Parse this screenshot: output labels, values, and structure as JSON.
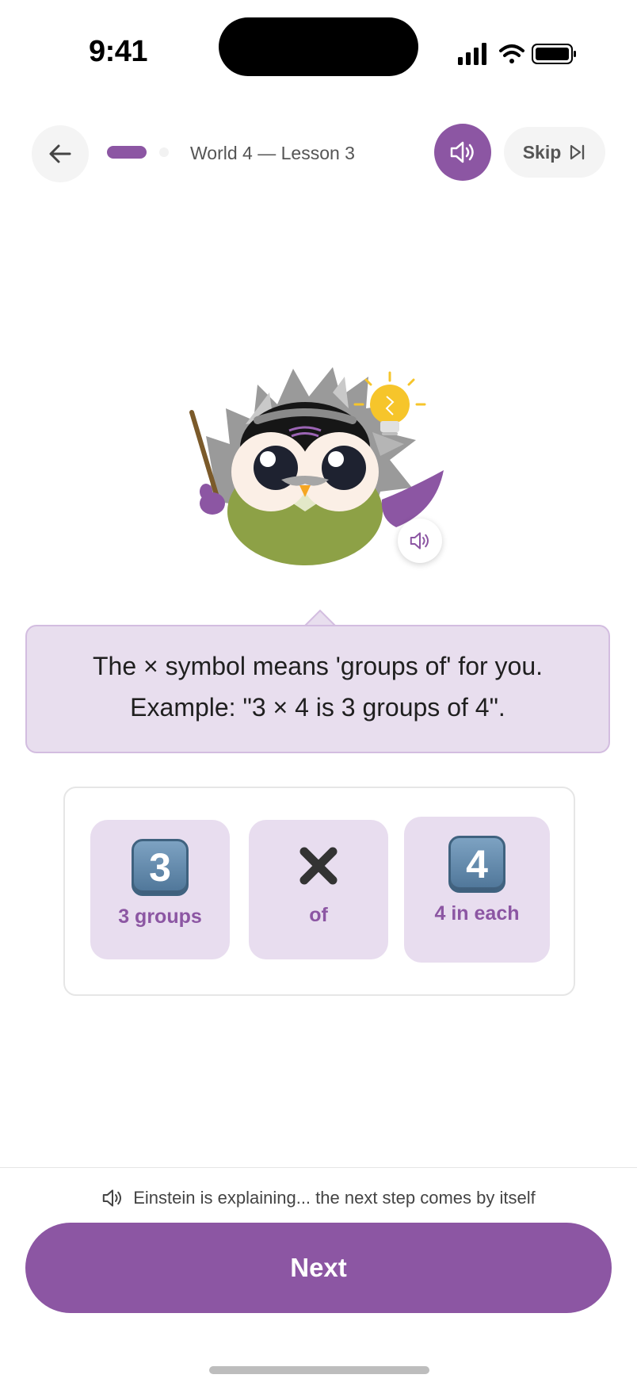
{
  "status_bar": {
    "time": "9:41"
  },
  "header": {
    "lesson_title": "World 4 — Lesson 3",
    "skip_label": "Skip",
    "progress_fraction": 0.5
  },
  "speech_bubble": {
    "line1": "The × symbol means 'groups of' for you.",
    "line2": "Example: \"3 × 4 is 3 groups of 4\"."
  },
  "example": {
    "tiles": [
      {
        "glyph": "3",
        "label": "3 groups",
        "icon": "keycap-3-icon"
      },
      {
        "glyph": "×",
        "label": "of",
        "icon": "multiply-icon"
      },
      {
        "glyph": "4",
        "label": "4 in each",
        "icon": "keycap-4-icon"
      }
    ]
  },
  "footer": {
    "status_message": "Einstein is explaining... the next step comes by itself",
    "next_label": "Next"
  },
  "colors": {
    "accent": "#8c56a3",
    "tile_bg": "#e8ddef",
    "bubble_bg": "#e8deee"
  }
}
